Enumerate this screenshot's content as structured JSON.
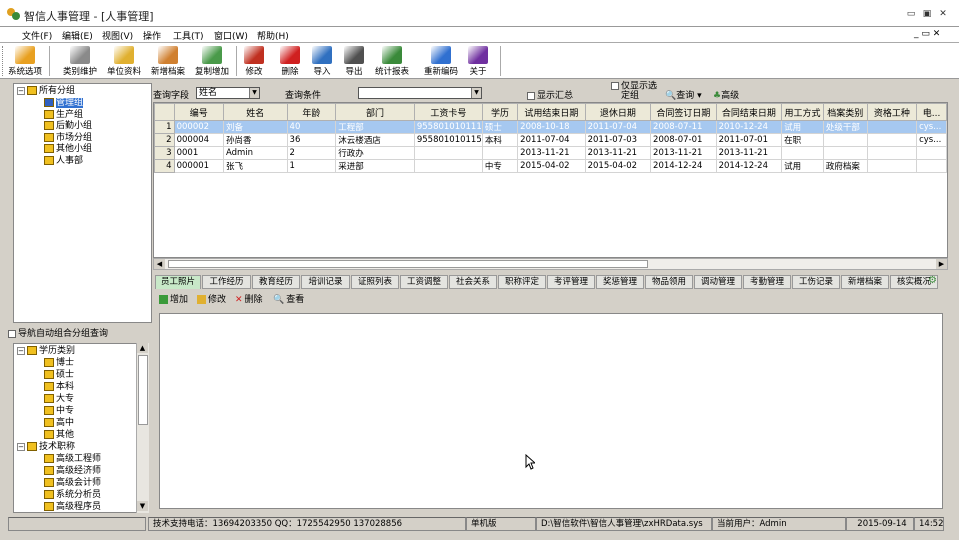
{
  "titlebar": {
    "title": "智信人事管理 - [人事管理]",
    "min": "▭",
    "restore": "▣",
    "close": "✕"
  },
  "menu": {
    "items": [
      "文件(F)",
      "编辑(E)",
      "视图(V)",
      "操作",
      "工具(T)",
      "窗口(W)",
      "帮助(H)"
    ],
    "mdi_controls": "_ ▭ ✕"
  },
  "toolbar": {
    "buttons": [
      {
        "label": "系统选项",
        "icon": "wrench-icon",
        "color": "#e8a020"
      },
      {
        "label": "类别维护",
        "icon": "tools-icon",
        "color": "#8a8a8a"
      },
      {
        "label": "单位资料",
        "icon": "book-icon",
        "color": "#e0b030"
      },
      {
        "label": "新增档案",
        "icon": "add-person-icon",
        "color": "#d08030"
      },
      {
        "label": "复制增加",
        "icon": "copy-icon",
        "color": "#4a9a4a"
      },
      {
        "label": "修改",
        "icon": "pencil-icon",
        "color": "#c03020"
      },
      {
        "label": "删除",
        "icon": "delete-x-icon",
        "color": "#d02020"
      },
      {
        "label": "导入",
        "icon": "import-icon",
        "color": "#3070c0"
      },
      {
        "label": "导出",
        "icon": "printer-icon",
        "color": "#505050"
      },
      {
        "label": "统计报表",
        "icon": "chart-icon",
        "color": "#3a8a3a"
      },
      {
        "label": "重新编码",
        "icon": "recode-icon",
        "color": "#3070d0"
      },
      {
        "label": "关于",
        "icon": "help-icon",
        "color": "#7030a0"
      }
    ]
  },
  "org_tree": {
    "root": "所有分组",
    "children": [
      "管理组",
      "生产组",
      "后勤小组",
      "市场分组",
      "其他小组",
      "人事部"
    ],
    "selected": "管理组"
  },
  "nav_combo_label": "导航自动组合分组查询",
  "category_tree": {
    "groups": [
      {
        "label": "学历类别",
        "items": [
          "博士",
          "硕士",
          "本科",
          "大专",
          "中专",
          "高中",
          "其他"
        ]
      },
      {
        "label": "技术职称",
        "items": [
          "高级工程师",
          "高级经济师",
          "高级会计师",
          "系统分析员",
          "高级程序员"
        ]
      }
    ]
  },
  "query": {
    "field_label": "查询字段",
    "field_value": "姓名",
    "condition_label": "查询条件",
    "condition_value": "",
    "show_summary": "显示汇总",
    "filter_only": "仅显示选",
    "filter_only2": "定组",
    "query_btn": "查询",
    "advanced_btn": "高级"
  },
  "grid": {
    "columns": [
      "编号",
      "姓名",
      "年龄",
      "部门",
      "工资卡号",
      "学历",
      "试用结束日期",
      "退休日期",
      "合同签订日期",
      "合同结束日期",
      "用工方式",
      "档案类别",
      "资格工种",
      "电..."
    ],
    "rows": [
      [
        "1",
        "000002",
        "刘备",
        "40",
        "工程部",
        "955801010111",
        "硕士",
        "2008-10-18",
        "2011-07-04",
        "2008-07-11",
        "2010-12-24",
        "试用",
        "处级干部",
        "",
        "cys..."
      ],
      [
        "2",
        "000004",
        "孙尚香",
        "36",
        "沐云楼酒店",
        "955801010115",
        "本科",
        "2011-07-04",
        "2011-07-03",
        "2008-07-01",
        "2011-07-01",
        "在职",
        "",
        "",
        "cys..."
      ],
      [
        "3",
        "0001",
        "Admin",
        "2",
        "行政办",
        "",
        "",
        "2013-11-21",
        "2013-11-21",
        "2013-11-21",
        "2013-11-21",
        "",
        "",
        "",
        ""
      ],
      [
        "4",
        "000001",
        "张飞",
        "1",
        "采进部",
        "",
        "中专",
        "2015-04-02",
        "2015-04-02",
        "2014-12-24",
        "2014-12-24",
        "试用",
        "政府档案",
        "",
        ""
      ]
    ],
    "selected_row": 0
  },
  "tabs": [
    "员工照片",
    "工作经历",
    "教育经历",
    "培训记录",
    "证照列表",
    "工资调整",
    "社会关系",
    "职称评定",
    "考评管理",
    "奖惩管理",
    "物品领用",
    "调动管理",
    "考勤管理",
    "工伤记录",
    "新增档案",
    "核实概况"
  ],
  "active_tab": 0,
  "subtool": {
    "add": "增加",
    "edit": "修改",
    "delete": "删除",
    "view": "查看"
  },
  "statusbar": {
    "support": "技术支持电话：13694203350 QQ：1725542950 137028856",
    "mode": "单机版",
    "path": "D:\\智信软件\\智信人事管理\\zxHRData.sys",
    "user": "当前用户：Admin",
    "date": "2015-09-14",
    "time": "14:52"
  }
}
